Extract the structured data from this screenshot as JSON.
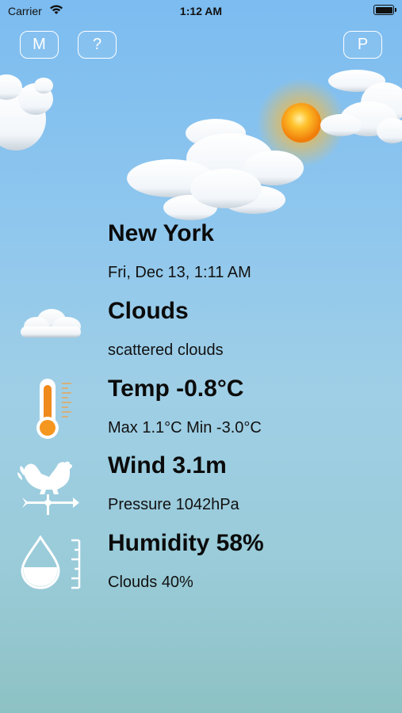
{
  "status_bar": {
    "carrier": "Carrier",
    "time": "1:12 AM",
    "icons": [
      "wifi-icon",
      "battery-icon"
    ]
  },
  "top_buttons": {
    "left1": "M",
    "left2": "?",
    "right": "P"
  },
  "weather": {
    "city": "New York",
    "datetime": "Fri, Dec 13, 1:11 AM",
    "condition": "Clouds",
    "description": "scattered clouds",
    "temp": "Temp -0.8°C",
    "temp_range": "Max 1.1°C Min -3.0°C",
    "wind": "Wind 3.1m",
    "pressure": "Pressure 1042hPa",
    "humidity": "Humidity 58%",
    "clouds": "Clouds 40%"
  },
  "colors": {
    "sky_top": "#7cbcf0",
    "sky_bottom": "#8dc2c4",
    "sun": "#f7a21b",
    "thermometer": "#f08a1c"
  },
  "icons": [
    "cloud-icon",
    "thermometer-icon",
    "weathervane-icon",
    "humidity-drop-icon",
    "sun-icon"
  ]
}
